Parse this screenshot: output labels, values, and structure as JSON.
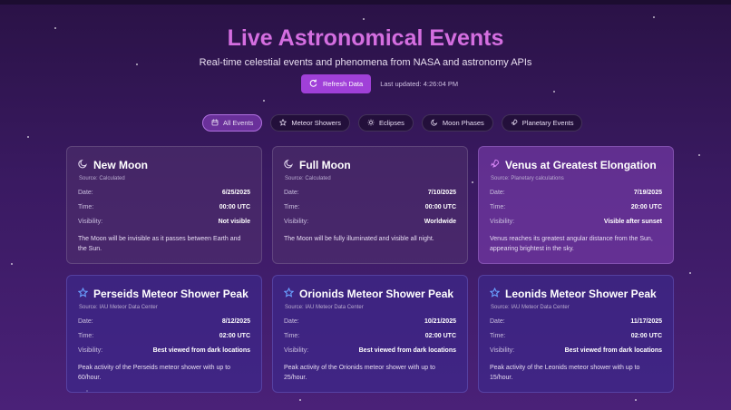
{
  "header": {
    "title": "Live Astronomical Events",
    "subtitle": "Real-time celestial events and phenomena from NASA and astronomy APIs",
    "refresh_label": "Refresh Data",
    "last_updated": "Last updated: 4:26:04 PM"
  },
  "filters": [
    {
      "label": "All Events",
      "icon": "calendar-icon",
      "active": true
    },
    {
      "label": "Meteor Showers",
      "icon": "star-icon",
      "active": false
    },
    {
      "label": "Eclipses",
      "icon": "sun-icon",
      "active": false
    },
    {
      "label": "Moon Phases",
      "icon": "moon-icon",
      "active": false
    },
    {
      "label": "Planetary Events",
      "icon": "rocket-icon",
      "active": false
    }
  ],
  "labels": {
    "date": "Date:",
    "time": "Time:",
    "visibility": "Visibility:"
  },
  "events": [
    {
      "title": "New Moon",
      "source": "Source: Calculated",
      "date": "6/25/2025",
      "time": "00:00 UTC",
      "visibility": "Not visible",
      "description": "The Moon will be invisible as it passes between Earth and the Sun.",
      "icon": "moon-icon"
    },
    {
      "title": "Full Moon",
      "source": "Source: Calculated",
      "date": "7/10/2025",
      "time": "00:00 UTC",
      "visibility": "Worldwide",
      "description": "The Moon will be fully illuminated and visible all night.",
      "icon": "moon-icon"
    },
    {
      "title": "Venus at Greatest Elongation",
      "source": "Source: Planetary calculations",
      "date": "7/19/2025",
      "time": "20:00 UTC",
      "visibility": "Visible after sunset",
      "description": "Venus reaches its greatest angular distance from the Sun, appearing brightest in the sky.",
      "icon": "rocket-icon"
    },
    {
      "title": "Perseids Meteor Shower Peak",
      "source": "Source: IAU Meteor Data Center",
      "date": "8/12/2025",
      "time": "02:00 UTC",
      "visibility": "Best viewed from dark locations",
      "description": "Peak activity of the Perseids meteor shower with up to 60/hour.",
      "icon": "star-icon"
    },
    {
      "title": "Orionids Meteor Shower Peak",
      "source": "Source: IAU Meteor Data Center",
      "date": "10/21/2025",
      "time": "02:00 UTC",
      "visibility": "Best viewed from dark locations",
      "description": "Peak activity of the Orionids meteor shower with up to 25/hour.",
      "icon": "star-icon"
    },
    {
      "title": "Leonids Meteor Shower Peak",
      "source": "Source: IAU Meteor Data Center",
      "date": "11/17/2025",
      "time": "02:00 UTC",
      "visibility": "Best viewed from dark locations",
      "description": "Peak activity of the Leonids meteor shower with up to 15/hour.",
      "icon": "star-icon"
    }
  ],
  "colors": {
    "accent": "#a040d8",
    "title": "#d46ee0",
    "moon_icon": "#e6dcf2",
    "planet_icon": "#d080f0",
    "meteor_icon": "#6aa0ff"
  }
}
